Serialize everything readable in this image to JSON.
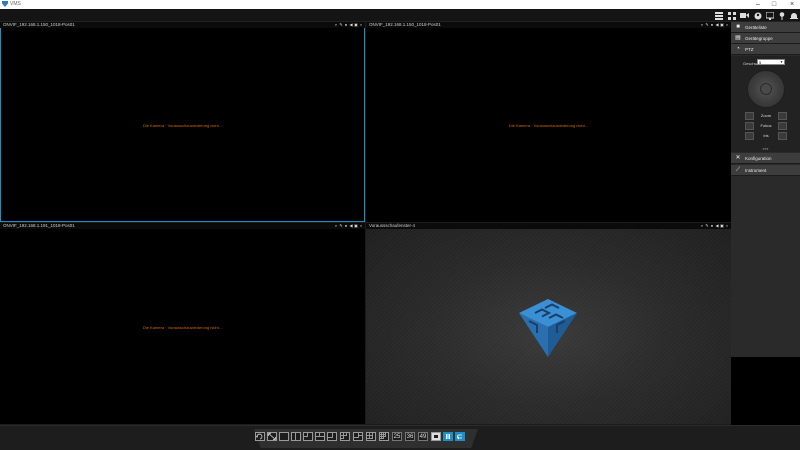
{
  "window": {
    "title": "VMS",
    "buttons": [
      "minimize",
      "maximize",
      "close"
    ]
  },
  "toolbar": {
    "icons": [
      "layout-list-icon",
      "layout-grid-icon",
      "camera-icon",
      "user-icon",
      "monitor-icon",
      "pin-icon",
      "alarm-icon"
    ]
  },
  "panes": [
    {
      "title": "ONVIF_192.168.1.150_1018-Pos01",
      "message": "Die Kamera · Vorausschauwiederung nicht..."
    },
    {
      "title": "ONVIF_192.168.1.150_1018-Pos01",
      "message": "Die Kamera · Vorausschauwiederung nicht..."
    },
    {
      "title": "ONVIF_192.168.1.191_1018-Pos01",
      "message": "Die Kamera · Vorausschauwiederung nicht..."
    },
    {
      "title": "Voraussschaufenster-4",
      "message": ""
    }
  ],
  "sidebar": {
    "header_items": [
      {
        "label": "Geräteliste",
        "icon": "camera-icon"
      },
      {
        "label": "Gerätegruppe",
        "icon": "group-icon"
      },
      {
        "label": "PTZ",
        "icon": "ptz-icon"
      }
    ],
    "ptz": {
      "speed_label": "Geschw.",
      "speed_value": "5",
      "zoom_label": "Zoom",
      "focus_label": "Fokus",
      "iris_label": "Iris",
      "more_label": "PTZ"
    },
    "footer_items": [
      {
        "label": "Konfiguration",
        "icon": "wrench-icon"
      },
      {
        "label": "Instrument",
        "icon": "tool-icon"
      }
    ]
  },
  "bottom_bar": {
    "layout_numbers": [
      "25",
      "36",
      "49"
    ],
    "colors": {
      "accent": "#1d8fc7"
    }
  }
}
